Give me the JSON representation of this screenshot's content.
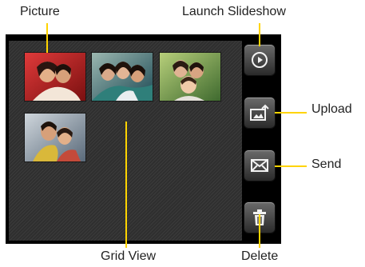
{
  "callouts": {
    "picture": "Picture",
    "launch_slideshow": "Launch Slideshow",
    "upload": "Upload",
    "send": "Send",
    "grid_view": "Grid View",
    "delete": "Delete"
  },
  "buttons": [
    {
      "name": "launch-slideshow-button",
      "icon": "play-icon"
    },
    {
      "name": "upload-button",
      "icon": "upload-icon"
    },
    {
      "name": "send-button",
      "icon": "envelope-icon"
    },
    {
      "name": "delete-button",
      "icon": "trash-icon"
    }
  ],
  "thumbnails": [
    {
      "name": "photo-couple-red",
      "colors": [
        "#c8202a",
        "#8a1a1a",
        "#e0a58a"
      ]
    },
    {
      "name": "photo-group-teal",
      "colors": [
        "#2f7f7a",
        "#1d4a55",
        "#d7a98a"
      ]
    },
    {
      "name": "photo-family-green",
      "colors": [
        "#7aa04a",
        "#3f6a2f",
        "#e6c3a0"
      ]
    },
    {
      "name": "photo-couple-yellow",
      "colors": [
        "#d9b83a",
        "#5a6a7a",
        "#d9a582"
      ]
    }
  ],
  "colors": {
    "callout_line": "#ffd400",
    "screen_bg": "#2f2f2f",
    "frame": "#000000"
  }
}
